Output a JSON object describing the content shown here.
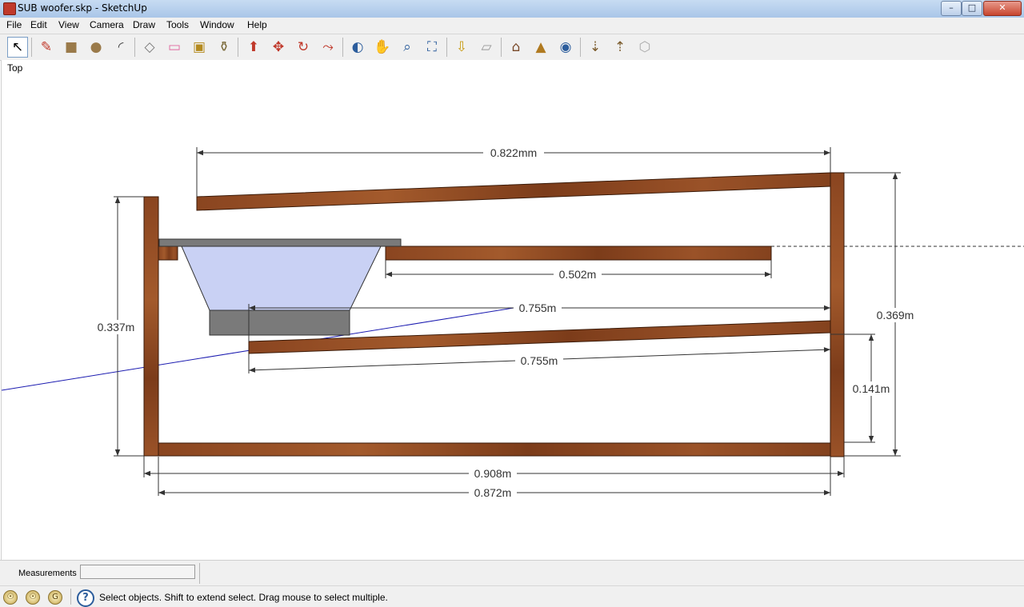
{
  "window": {
    "title": "SUB woofer.skp - SketchUp",
    "minimize": "–",
    "maximize": "□",
    "close": "✕"
  },
  "menu": [
    "File",
    "Edit",
    "View",
    "Camera",
    "Draw",
    "Tools",
    "Window",
    "Help"
  ],
  "toolbar": {
    "tools": [
      {
        "name": "select-icon",
        "glyph": "↖"
      },
      {
        "name": "pencil-icon",
        "glyph": "✎"
      },
      {
        "name": "rectangle-icon",
        "glyph": "■"
      },
      {
        "name": "circle-icon",
        "glyph": "●"
      },
      {
        "name": "arc-icon",
        "glyph": "◜"
      },
      {
        "name": "make-component-icon",
        "glyph": "◇"
      },
      {
        "name": "eraser-icon",
        "glyph": "▭"
      },
      {
        "name": "tape-measure-icon",
        "glyph": "▣"
      },
      {
        "name": "paint-bucket-icon",
        "glyph": "⚱"
      },
      {
        "name": "push-pull-icon",
        "glyph": "⬆"
      },
      {
        "name": "move-icon",
        "glyph": "✥"
      },
      {
        "name": "rotate-icon",
        "glyph": "↻"
      },
      {
        "name": "offset-icon",
        "glyph": "⤳"
      },
      {
        "name": "orbit-icon",
        "glyph": "◐"
      },
      {
        "name": "pan-icon",
        "glyph": "✋"
      },
      {
        "name": "zoom-icon",
        "glyph": "⌕"
      },
      {
        "name": "zoom-extents-icon",
        "glyph": "⛶"
      },
      {
        "name": "previous-view-icon",
        "glyph": "⇩"
      },
      {
        "name": "next-view-icon",
        "glyph": "▱"
      },
      {
        "name": "add-location-icon",
        "glyph": "⌂"
      },
      {
        "name": "toggle-terrain-icon",
        "glyph": "▲"
      },
      {
        "name": "google-earth-icon",
        "glyph": "◉"
      },
      {
        "name": "get-models-icon",
        "glyph": "⇣"
      },
      {
        "name": "share-model-icon",
        "glyph": "⇡"
      },
      {
        "name": "share-component-icon",
        "glyph": "⬡"
      }
    ]
  },
  "view_label": "Top",
  "dimensions": {
    "top_board_length": "0.822mm",
    "inner_shelf_length": "0.502m",
    "upper_port_length": "0.755m",
    "lower_port_length": "0.755m",
    "left_height": "0.337m",
    "right_height": "0.369m",
    "port_gap": "0.141m",
    "outer_width": "0.908m",
    "inner_width": "0.872m"
  },
  "colors": {
    "wood": "#8a4520",
    "wood_dark": "#5c2a10",
    "speaker_cone": "#c9d1f4",
    "speaker_magnet": "#7a7a7a",
    "guide_line": "#1b1bb0",
    "dimension_line": "#333333"
  },
  "measurements": {
    "label": "Measurements",
    "value": ""
  },
  "status": {
    "hint_icons": [
      "☉",
      "☉",
      "G"
    ],
    "help": "?",
    "text": "Select objects. Shift to extend select. Drag mouse to select multiple."
  }
}
